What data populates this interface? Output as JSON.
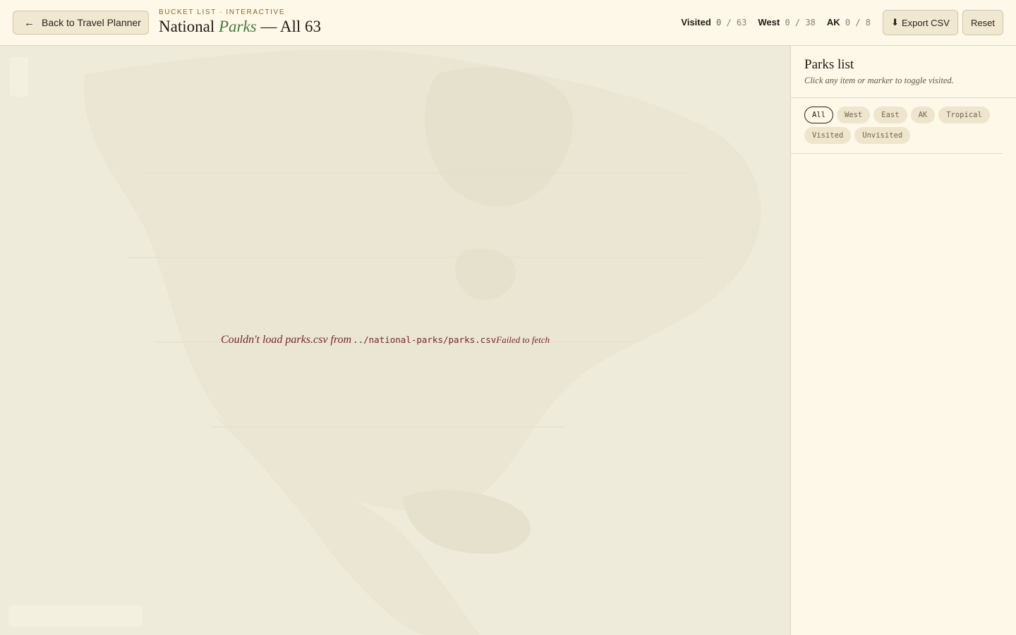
{
  "header": {
    "back_label": "Back to Travel Planner",
    "eyebrow": "Bucket list · Interactive",
    "title_pre": "National ",
    "title_accent": "Parks",
    "title_post": " — All 63",
    "stats": [
      {
        "label": "Visited",
        "value": "0",
        "total": "/ 63"
      },
      {
        "label": "West",
        "value": "0",
        "total": "/ 38"
      },
      {
        "label": "AK",
        "value": "0",
        "total": "/ 8"
      }
    ],
    "export_label": "Export CSV",
    "reset_label": "Reset"
  },
  "map": {
    "error_prefix": "Couldn't load parks.csv from",
    "error_path": "../national-parks/parks.csv",
    "error_detail": "Failed to fetch"
  },
  "sidebar": {
    "title": "Parks list",
    "subtitle": "Click any item or marker to toggle visited.",
    "filters": [
      "All",
      "West",
      "East",
      "AK",
      "Tropical",
      "Visited",
      "Unvisited"
    ],
    "active_filter": "All"
  },
  "colors": {
    "background": "#fdf8e8",
    "accent": "#4a7a40",
    "error": "#7a2430",
    "map": "#efebdb"
  }
}
